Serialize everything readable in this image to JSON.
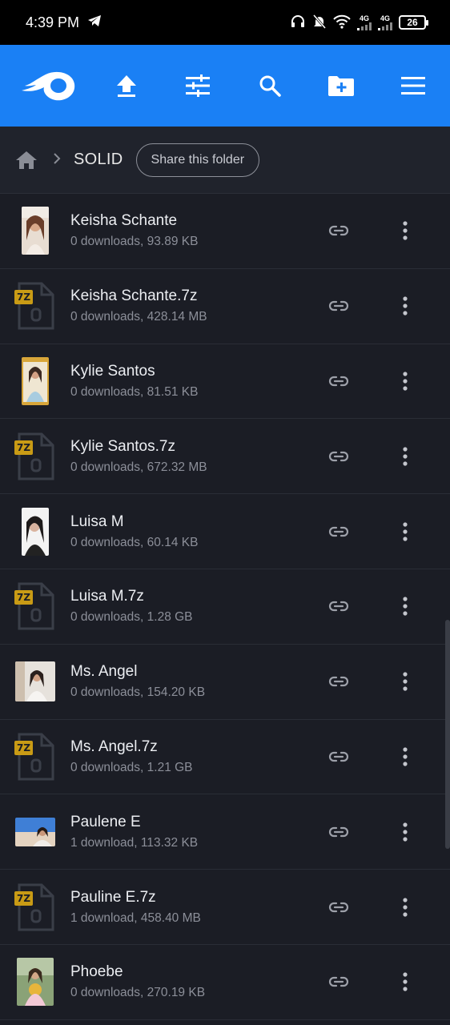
{
  "status_bar": {
    "time": "4:39 PM",
    "battery": "26",
    "net1": "4G",
    "net2": "4G"
  },
  "app_bar": {
    "accent": "#1a80f5",
    "icons": [
      "mediafire-logo-icon",
      "upload-icon",
      "filter-sliders-icon",
      "search-icon",
      "new-folder-icon",
      "menu-icon"
    ]
  },
  "breadcrumb": {
    "folder": "SOLID",
    "share_label": "Share this folder"
  },
  "files": [
    {
      "name": "Keisha Schante",
      "meta": "0 downloads, 93.89 KB",
      "type": "image",
      "thumb": "portrait-a"
    },
    {
      "name": "Keisha Schante.7z",
      "meta": "0 downloads, 428.14 MB",
      "type": "7z"
    },
    {
      "name": "Kylie Santos",
      "meta": "0 downloads, 81.51 KB",
      "type": "image",
      "thumb": "portrait-b"
    },
    {
      "name": "Kylie Santos.7z",
      "meta": "0 downloads, 672.32 MB",
      "type": "7z"
    },
    {
      "name": "Luisa M",
      "meta": "0 downloads, 60.14 KB",
      "type": "image",
      "thumb": "portrait-c"
    },
    {
      "name": "Luisa M.7z",
      "meta": "0 downloads, 1.28 GB",
      "type": "7z"
    },
    {
      "name": "Ms. Angel",
      "meta": "0 downloads, 154.20 KB",
      "type": "image",
      "thumb": "landscape-a"
    },
    {
      "name": "Ms. Angel.7z",
      "meta": "0 downloads, 1.21 GB",
      "type": "7z"
    },
    {
      "name": "Paulene E",
      "meta": "1 download, 113.32 KB",
      "type": "image",
      "thumb": "landscape-b"
    },
    {
      "name": "Pauline E.7z",
      "meta": "1 download, 458.40 MB",
      "type": "7z"
    },
    {
      "name": "Phoebe",
      "meta": "0 downloads, 270.19 KB",
      "type": "image",
      "thumb": "square-a"
    }
  ],
  "badge_label": "7Z"
}
